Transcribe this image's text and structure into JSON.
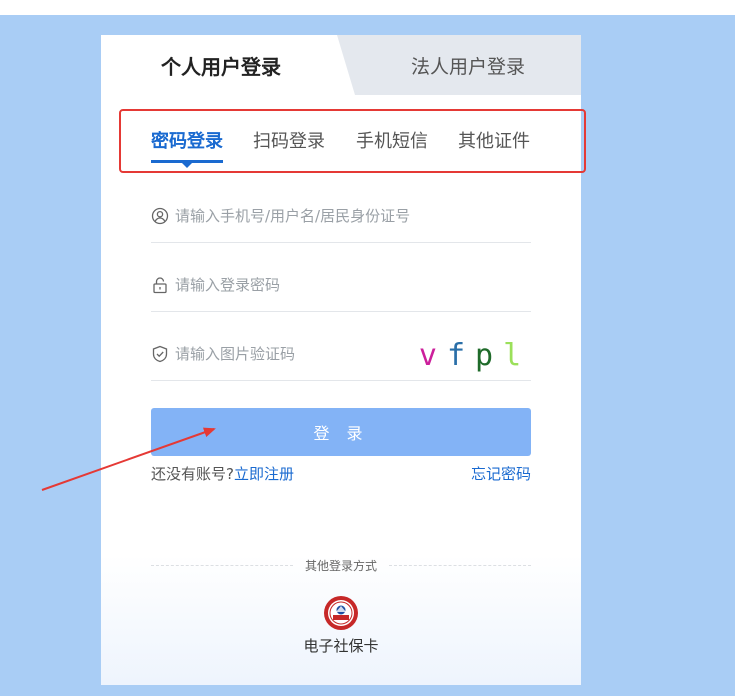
{
  "tabs": {
    "personal": "个人用户登录",
    "corporate": "法人用户登录"
  },
  "subtabs": [
    {
      "label": "密码登录",
      "active": true
    },
    {
      "label": "扫码登录",
      "active": false
    },
    {
      "label": "手机短信",
      "active": false
    },
    {
      "label": "其他证件",
      "active": false
    }
  ],
  "form": {
    "username_placeholder": "请输入手机号/用户名/居民身份证号",
    "password_placeholder": "请输入登录密码",
    "captcha_placeholder": "请输入图片验证码",
    "captcha_chars": [
      "v",
      "f",
      "p",
      "l"
    ],
    "captcha_colors": [
      "#cc1f9b",
      "#2a6fa8",
      "#1f6b2a",
      "#9be05a"
    ],
    "login_button": "登 录"
  },
  "register": {
    "question": "还没有账号?",
    "register_link": "立即注册",
    "forgot_link": "忘记密码"
  },
  "other_login": {
    "label": "其他登录方式",
    "social_card_label": "电子社保卡"
  },
  "colors": {
    "accent": "#1a6ad0",
    "button": "#83b3f6",
    "background": "#a9cdf5",
    "highlight": "#e53935"
  }
}
